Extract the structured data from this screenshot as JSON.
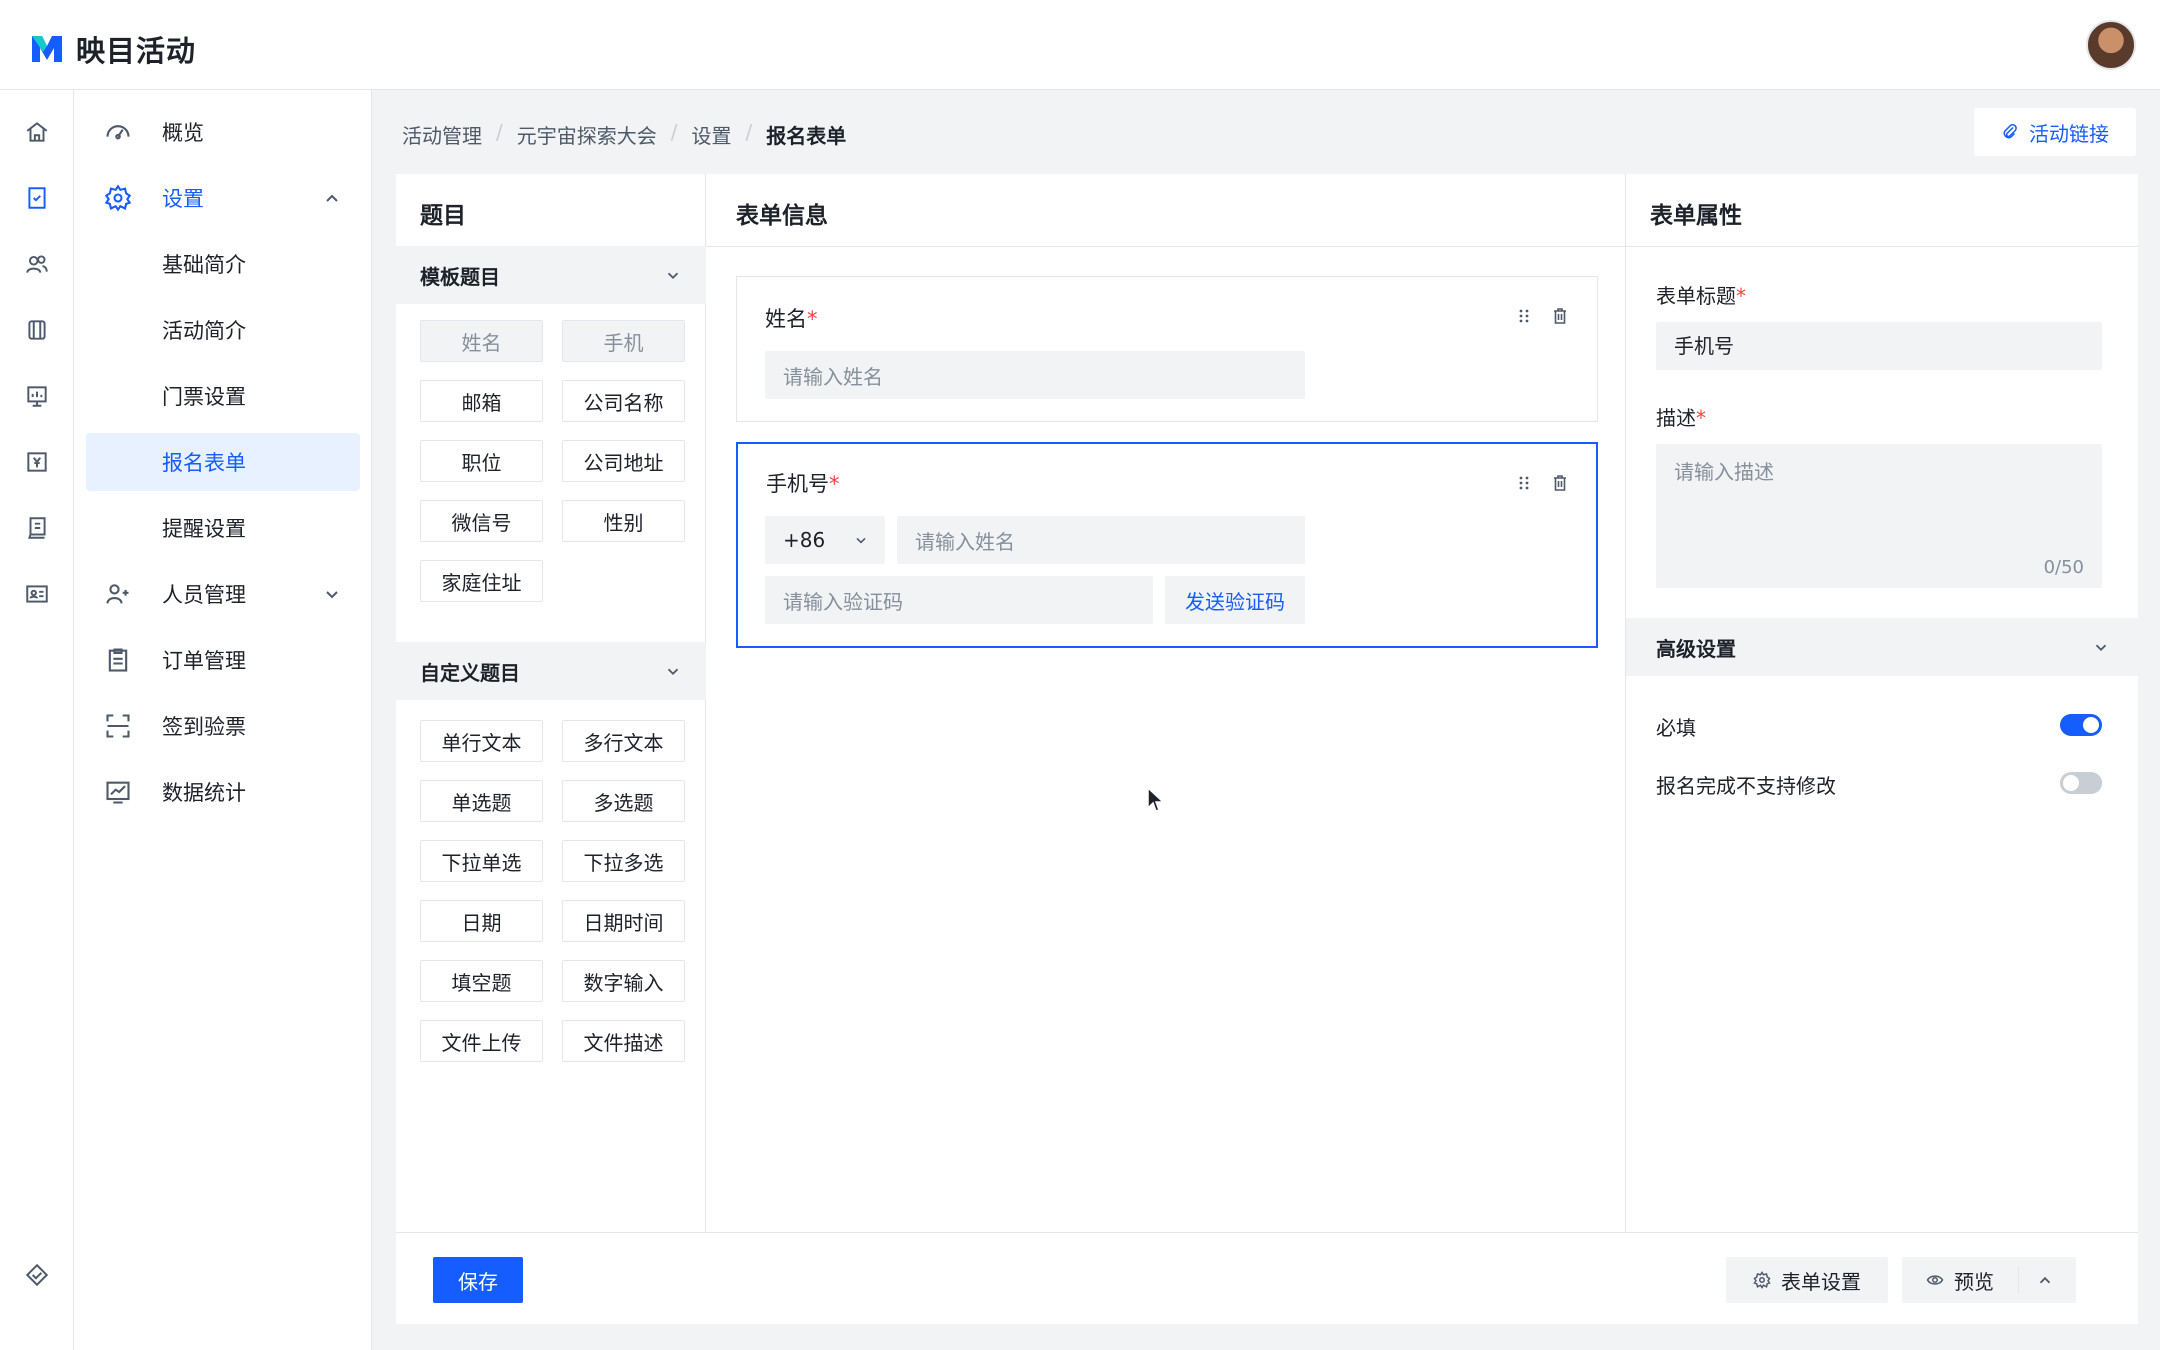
{
  "app": {
    "name": "映目活动",
    "brand_color": "#165dff"
  },
  "sidebar": {
    "items": [
      {
        "label": "概览",
        "icon": "dashboard-icon"
      },
      {
        "label": "设置",
        "icon": "gear-icon"
      },
      {
        "label": "基础简介"
      },
      {
        "label": "活动简介"
      },
      {
        "label": "门票设置"
      },
      {
        "label": "报名表单"
      },
      {
        "label": "提醒设置"
      },
      {
        "label": "人员管理",
        "icon": "users-icon"
      },
      {
        "label": "订单管理",
        "icon": "clipboard-icon"
      },
      {
        "label": "签到验票",
        "icon": "scan-icon"
      },
      {
        "label": "数据统计",
        "icon": "chart-icon"
      }
    ]
  },
  "breadcrumb": {
    "l1": "活动管理",
    "l2": "元宇宙探索大会",
    "l3": "设置",
    "current": "报名表单",
    "sep": "/"
  },
  "link_button": "活动链接",
  "left": {
    "title": "题目",
    "template_group": "模板题目",
    "template_items": [
      "姓名",
      "手机",
      "邮箱",
      "公司名称",
      "职位",
      "公司地址",
      "微信号",
      "性别",
      "家庭住址"
    ],
    "custom_group": "自定义题目",
    "custom_items": [
      "单行文本",
      "多行文本",
      "单选题",
      "多选题",
      "下拉单选",
      "下拉多选",
      "日期",
      "日期时间",
      "填空题",
      "数字输入",
      "文件上传",
      "文件描述"
    ]
  },
  "middle": {
    "title": "表单信息",
    "fields": [
      {
        "label": "姓名",
        "placeholder": "请输入姓名"
      },
      {
        "label": "手机号",
        "country_code": "+86",
        "placeholder": "请输入姓名",
        "code_placeholder": "请输入验证码",
        "code_button": "发送验证码"
      }
    ],
    "required_mark": "*"
  },
  "right": {
    "title": "表单属性",
    "form_title_label": "表单标题",
    "form_title_value": "手机号",
    "desc_label": "描述",
    "desc_placeholder": "请输入描述",
    "desc_counter": "0/50",
    "advanced": "高级设置",
    "required_label": "必填",
    "required_on": true,
    "no_edit_label": "报名完成不支持修改",
    "no_edit_on": false
  },
  "footer": {
    "save": "保存",
    "form_settings": "表单设置",
    "preview": "预览"
  }
}
